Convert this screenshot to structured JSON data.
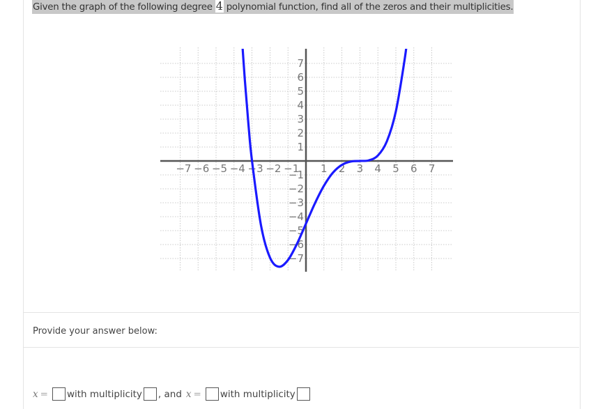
{
  "question": {
    "text_before": "Given the graph of the following degree",
    "degree": "4",
    "text_after": "polynomial function, find all of the zeros and their multiplicities."
  },
  "prompt_label": "Provide your answer below:",
  "answer_row": {
    "var": "x",
    "equals": "=",
    "with_multiplicity": "with multiplicity",
    "and": ", and",
    "zero1_value": "",
    "mult1_value": "",
    "zero2_value": "",
    "mult2_value": ""
  },
  "chart_data": {
    "type": "line",
    "xlim": [
      -8,
      8
    ],
    "ylim": [
      -8,
      8
    ],
    "grid": true,
    "x_ticks": [
      "-7",
      "-6",
      "-5",
      "-4",
      "-3",
      "-2",
      "-1",
      "1",
      "2",
      "3",
      "4",
      "5",
      "6",
      "7"
    ],
    "y_ticks": [
      "7",
      "6",
      "5",
      "4",
      "3",
      "2",
      "1",
      "-1",
      "-2",
      "-3",
      "-4",
      "-5",
      "-6",
      "-7"
    ],
    "curve_color": "#1a1aff",
    "series": [
      {
        "x": [
          -3.7,
          -3.6,
          -3.4,
          -3.2,
          -3,
          -2.5,
          -2,
          -1.5,
          -1,
          -0.5,
          0,
          0.5,
          1,
          1.5,
          2,
          2.5,
          3,
          3.5,
          4,
          4.5,
          5,
          5.5,
          5.7
        ],
        "y": [
          11.6,
          9.58,
          5.83,
          2.65,
          0,
          -4.62,
          -6.94,
          -7.59,
          -7.11,
          -5.95,
          -4.5,
          -3.04,
          -1.78,
          -0.84,
          -0.28,
          -0.04,
          0,
          0.045,
          0.39,
          1.41,
          3.56,
          7.38,
          9.51
        ]
      }
    ]
  }
}
